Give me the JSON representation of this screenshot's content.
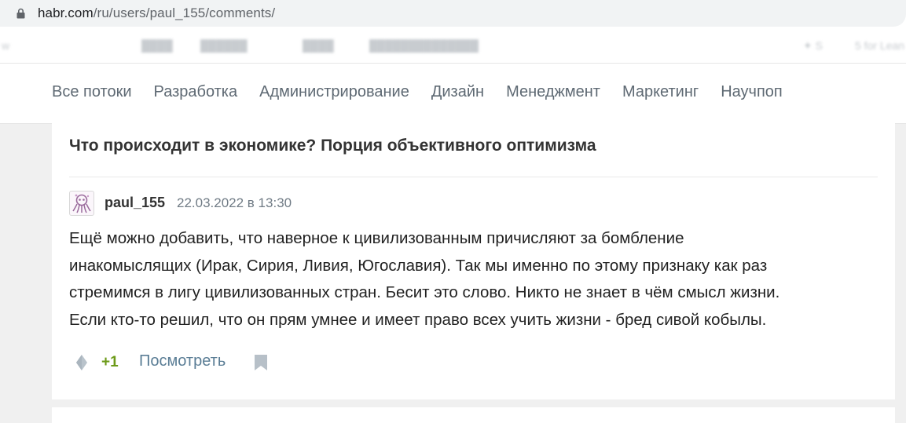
{
  "browser": {
    "url_host": "habr.com",
    "url_path": "/ru/users/paul_155/comments/"
  },
  "nav": {
    "items": [
      "Все потоки",
      "Разработка",
      "Администрирование",
      "Дизайн",
      "Менеджмент",
      "Маркетинг",
      "Научпоп"
    ]
  },
  "comment_card": {
    "post_title": "Что происходит в экономике? Порция объективного оптимизма",
    "author": "paul_155",
    "datetime": "22.03.2022 в 13:30",
    "text_lines": [
      "Ещё можно добавить, что наверное к цивилизованным причисляют за бомбление",
      "инакомыслящих (Ирак, Сирия, Ливия, Югославия). Так мы именно по этому признаку как раз",
      "стремимся в лигу цивилизованных стран. Бесит это слово. Никто не знает в чём смысл жизни.",
      "Если кто-то решил, что он прям умнее и имеет право всех учить жизни - бред сивой кобылы."
    ],
    "score": "+1",
    "view_label": "Посмотреть",
    "icons": [
      "vote-icon",
      "bookmark-icon",
      "lock-icon",
      "avatar"
    ]
  },
  "colors": {
    "score_green": "#6c9a18",
    "link_blue": "#5a7d95",
    "nav_text": "#5e6973"
  }
}
